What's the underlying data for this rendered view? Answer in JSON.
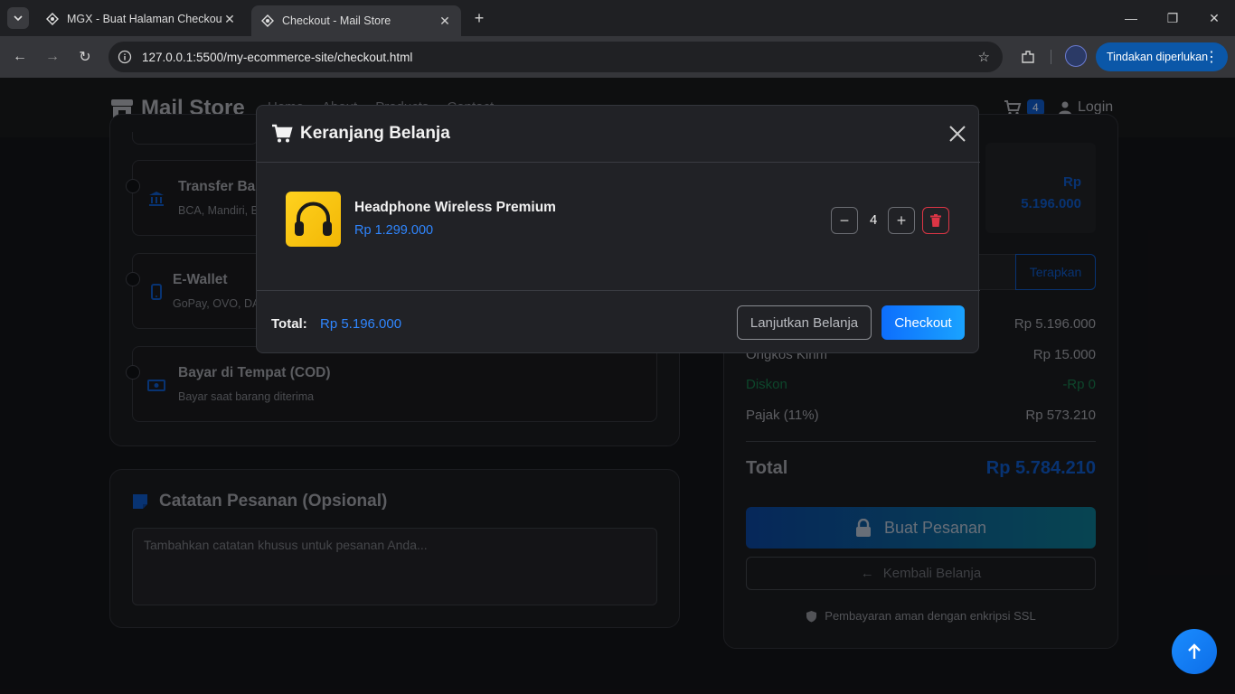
{
  "browser": {
    "tabs": [
      {
        "title": "MGX - Buat Halaman Checkout"
      },
      {
        "title": "Checkout - Mail Store"
      }
    ],
    "url": "127.0.0.1:5500/my-ecommerce-site/checkout.html",
    "action_label": "Tindakan diperlukan"
  },
  "navbar": {
    "brand": "Mail Store",
    "cart_count": "4",
    "login": "Login",
    "links": [
      "Home",
      "About",
      "Products",
      "Contact"
    ]
  },
  "payment": {
    "methods": [
      {
        "title": "Transfer Bank",
        "subtitle": "BCA, Mandiri, BNI, BRI"
      },
      {
        "title": "E-Wallet",
        "subtitle": "GoPay, OVO, DANA"
      },
      {
        "title": "Bayar di Tempat (COD)",
        "subtitle": "Bayar saat barang diterima"
      }
    ]
  },
  "notes": {
    "title": "Catatan Pesanan (Opsional)",
    "placeholder": "Tambahkan catatan khusus untuk pesanan Anda..."
  },
  "summary": {
    "item_total_line1": "Rp",
    "item_total_line2": "5.196.000",
    "apply_label": "Terapkan",
    "subtotal_value": "Rp 5.196.000",
    "shipping_label": "Ongkos Kirim",
    "shipping_value": "Rp 15.000",
    "discount_label": "Diskon",
    "discount_value": "-Rp 0",
    "tax_label": "Pajak (11%)",
    "tax_value": "Rp 573.210",
    "total_label": "Total",
    "total_value": "Rp 5.784.210",
    "order_button": "Buat Pesanan",
    "back_button": "Kembali Belanja",
    "ssl_note": "Pembayaran aman dengan enkripsi SSL"
  },
  "modal": {
    "title": "Keranjang Belanja",
    "item": {
      "name": "Headphone Wireless Premium",
      "price": "Rp 1.299.000",
      "qty": "4"
    },
    "total_label": "Total:",
    "total_value": "Rp 5.196.000",
    "continue_label": "Lanjutkan Belanja",
    "checkout_label": "Checkout"
  },
  "colors": {
    "accent": "#0d6efd",
    "danger": "#dc3545",
    "price": "#2f86ff"
  }
}
